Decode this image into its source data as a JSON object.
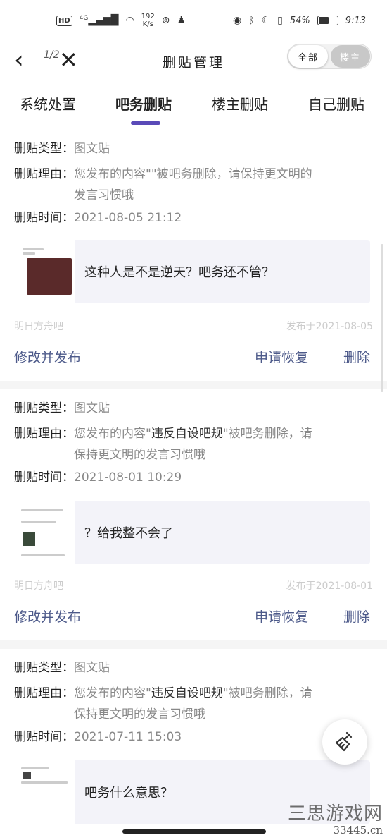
{
  "status_bar": {
    "hd": "HD",
    "network": "4G",
    "speed": "192",
    "speed_unit": "K/s",
    "battery": "54%",
    "time": "9:13"
  },
  "nav": {
    "page_indicator": "1/2",
    "title": "删贴管理",
    "toggle": {
      "all": "全部",
      "owner": "楼主"
    }
  },
  "tabs": [
    {
      "label": "系统处置"
    },
    {
      "label": "吧务删贴"
    },
    {
      "label": "楼主删贴"
    },
    {
      "label": "自己删贴"
    }
  ],
  "labels": {
    "type": "删贴类型：",
    "reason": "删贴理由：",
    "time": "删贴时间："
  },
  "posts": [
    {
      "type": "图文贴",
      "reason_line1": "您发布的内容\"\"被吧务删除，请保持更文明的",
      "reason_line2": "发言习惯哦",
      "time": "2021-08-05 21:12",
      "content": "这种人是不是逆天？吧务还不管？",
      "forum": "明日方舟吧",
      "published": "发布于2021-08-05",
      "action_edit": "修改并发布",
      "action_restore": "申请恢复",
      "action_delete": "删除"
    },
    {
      "type": "图文贴",
      "reason_prefix": "您发布的内容\"",
      "reason_highlight": "违反自设吧规",
      "reason_suffix": "\"被吧务删除，请",
      "reason_line2": "保持更文明的发言习惯哦",
      "time": "2021-08-01 10:29",
      "content": "？给我整不会了",
      "forum": "明日方舟吧",
      "published": "发布于2021-08-01",
      "action_edit": "修改并发布",
      "action_restore": "申请恢复",
      "action_delete": "删除"
    },
    {
      "type": "图文贴",
      "reason_prefix": "您发布的内容\"",
      "reason_highlight": "违反自设吧规",
      "reason_suffix": "\"被吧务删除，请",
      "reason_line2": "保持更文明的发言习惯哦",
      "time": "2021-07-11 15:03",
      "content": "吧务什么意思？"
    }
  ],
  "watermark": {
    "line1": "三思游戏网",
    "line2": "33445.cn"
  },
  "colors": {
    "accent": "#5a4ab8",
    "action": "#4d5a8a",
    "muted": "#888888",
    "meta": "#cccccc"
  }
}
